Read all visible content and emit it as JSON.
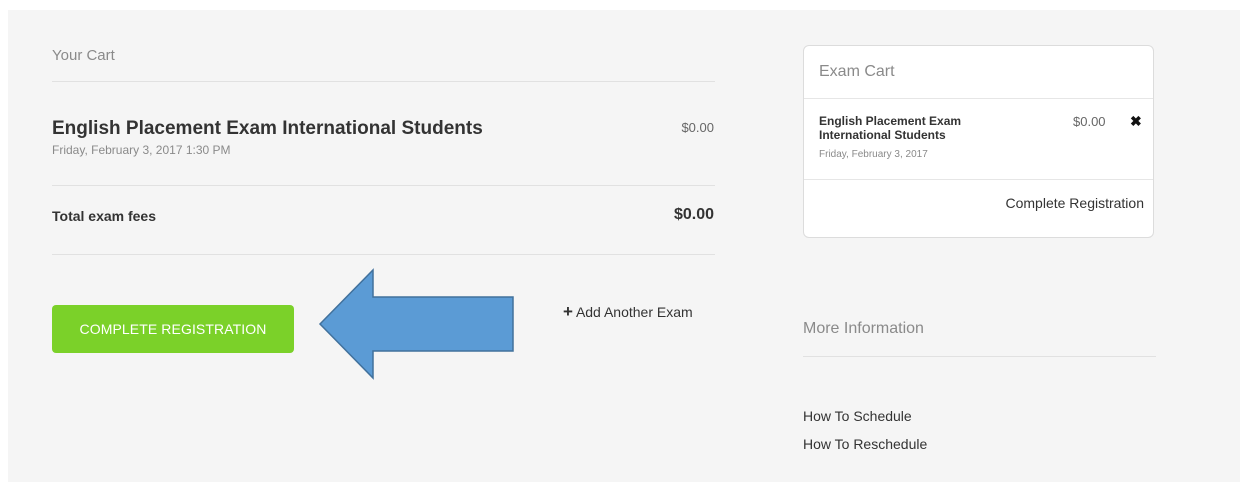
{
  "cart": {
    "title": "Your Cart",
    "item": {
      "name": "English Placement Exam International Students",
      "datetime": "Friday, February 3, 2017 1:30 PM",
      "price": "$0.00"
    },
    "total_label": "Total exam fees",
    "total_value": "$0.00",
    "complete_label": "COMPLETE REGISTRATION",
    "add_exam_label": "Add Another Exam"
  },
  "exam_cart": {
    "title": "Exam Cart",
    "item": {
      "name": "English Placement Exam International Students",
      "date": "Friday, February 3, 2017",
      "price": "$0.00"
    },
    "complete_label": "Complete Registration"
  },
  "more_info": {
    "title": "More Information",
    "links": [
      {
        "label": "How To Schedule"
      },
      {
        "label": "How To Reschedule"
      }
    ]
  },
  "colors": {
    "complete_button": "#7bd129",
    "arrow_fill": "#5b9bd5",
    "arrow_stroke": "#41719c"
  }
}
